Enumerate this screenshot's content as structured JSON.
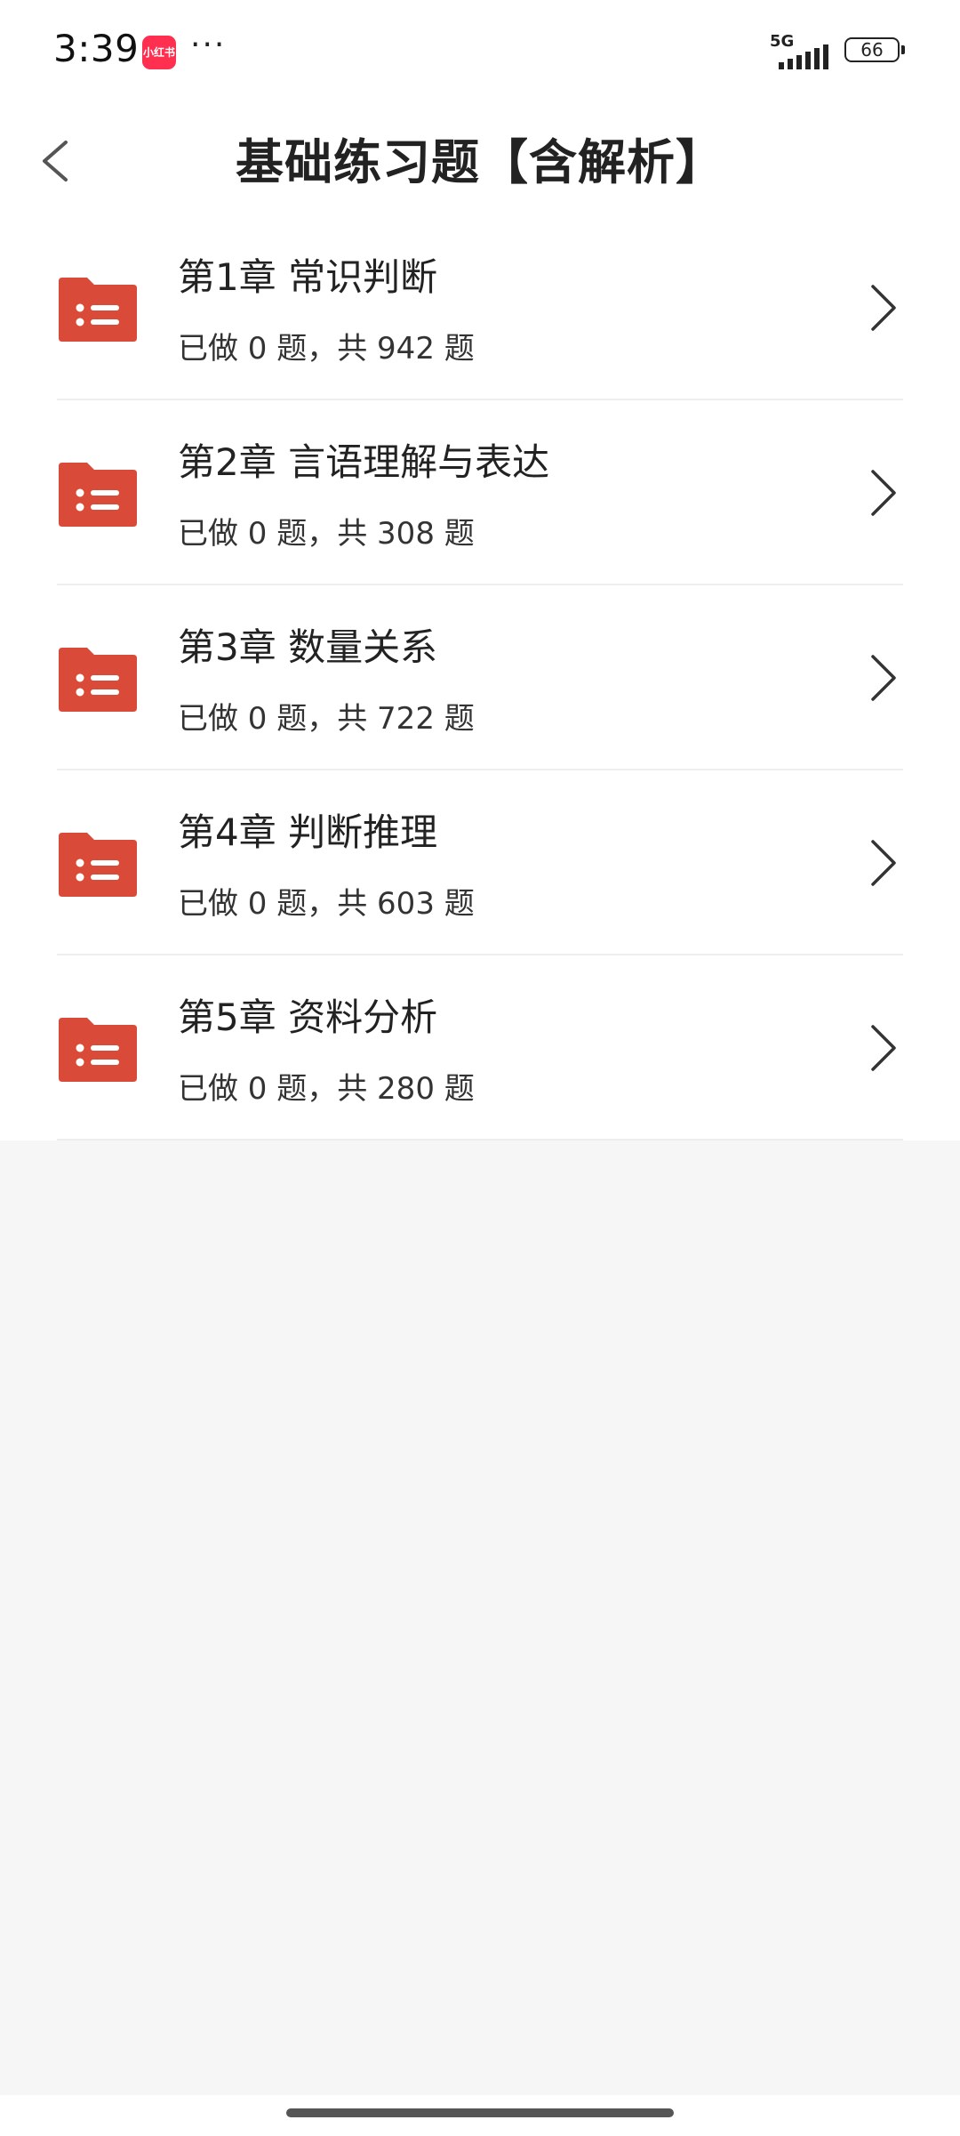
{
  "status": {
    "time": "3:39",
    "app_badge": "小红书",
    "more": "···",
    "network": "5G",
    "battery": "66"
  },
  "header": {
    "title": "基础练习题【含解析】"
  },
  "colors": {
    "accent": "#d94a38",
    "background": "#f6f6f6"
  },
  "chapters": [
    {
      "title": "第1章 常识判断",
      "progress": "已做 0 题，共 942 题"
    },
    {
      "title": "第2章 言语理解与表达",
      "progress": "已做 0 题，共 308 题"
    },
    {
      "title": "第3章 数量关系",
      "progress": "已做 0 题，共 722 题"
    },
    {
      "title": "第4章 判断推理",
      "progress": "已做 0 题，共 603 题"
    },
    {
      "title": "第5章 资料分析",
      "progress": "已做 0 题，共 280 题"
    }
  ]
}
